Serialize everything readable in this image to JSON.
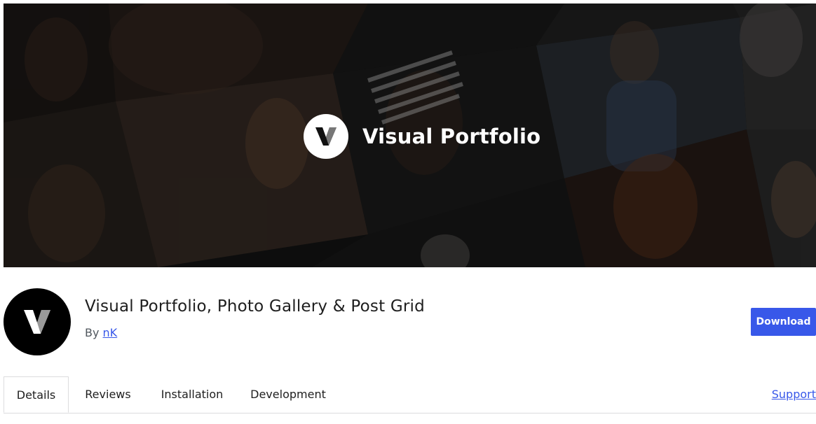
{
  "banner": {
    "brand_name": "Visual Portfolio",
    "logo_letter": "V",
    "background_color": "#1a1a1a",
    "description": "dark photo collage of portraits"
  },
  "plugin": {
    "title": "Visual Portfolio, Photo Gallery & Post Grid",
    "by_label": "By",
    "author": "nK",
    "icon": "visual-portfolio-logo-icon",
    "icon_letter": "V"
  },
  "actions": {
    "download_label": "Download"
  },
  "tabs": [
    {
      "label": "Details",
      "active": true
    },
    {
      "label": "Reviews",
      "active": false
    },
    {
      "label": "Installation",
      "active": false
    },
    {
      "label": "Development",
      "active": false
    }
  ],
  "support_label": "Support",
  "colors": {
    "accent": "#3858e9",
    "text": "#1e1e1e",
    "muted": "#50575e",
    "border": "#dcdcde"
  }
}
